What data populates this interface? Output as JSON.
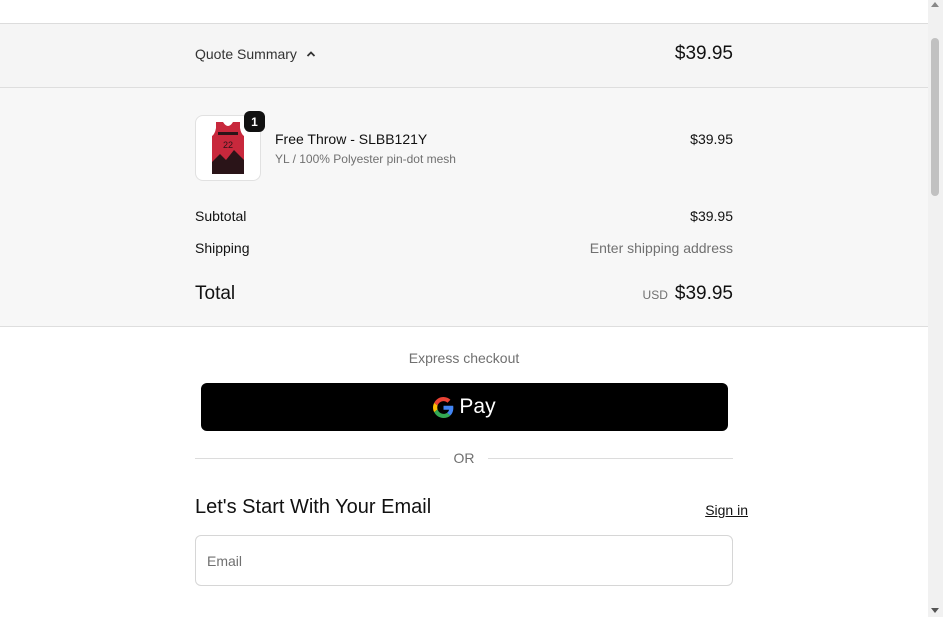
{
  "quote_summary": {
    "toggle_label": "Quote Summary",
    "toggle_icon": "chevron-up-icon",
    "price": "$39.95"
  },
  "line_item": {
    "quantity": "1",
    "name": "Free Throw - SLBB121Y",
    "variant": "YL / 100% Polyester pin-dot mesh",
    "price": "$39.95",
    "jersey_number": "22",
    "image_colors": {
      "primary": "#c8283c",
      "dark": "#2a1418"
    }
  },
  "totals": {
    "subtotal_label": "Subtotal",
    "subtotal_value": "$39.95",
    "shipping_label": "Shipping",
    "shipping_value": "Enter shipping address",
    "total_label": "Total",
    "currency": "USD",
    "total_value": "$39.95"
  },
  "checkout": {
    "express_label": "Express checkout",
    "gpay_label": "Pay",
    "or_label": "OR"
  },
  "email_section": {
    "heading": "Let's Start With Your Email",
    "sign_in_label": "Sign in",
    "email_placeholder": "Email",
    "email_value": ""
  }
}
